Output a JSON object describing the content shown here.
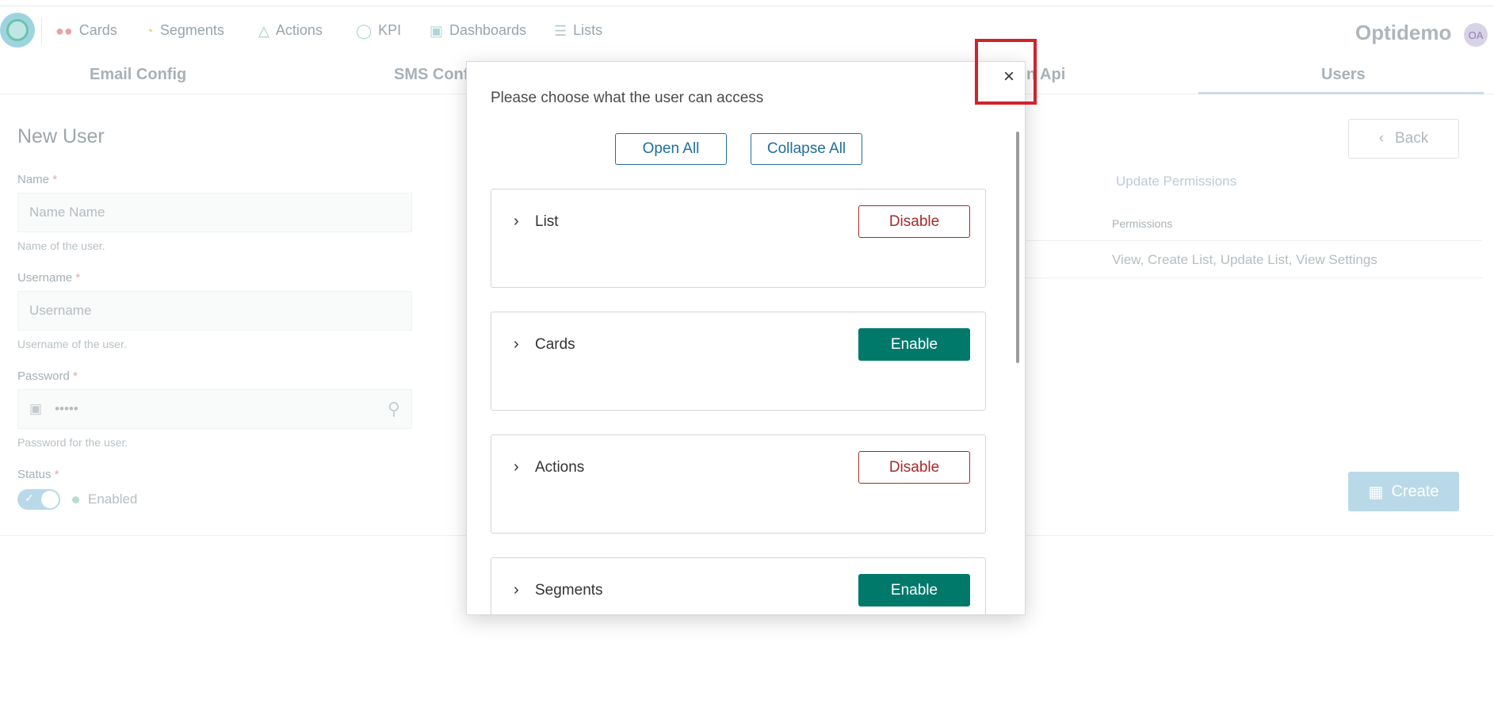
{
  "nav": {
    "items": [
      {
        "label": "Cards",
        "icon": "users-icon"
      },
      {
        "label": "Segments",
        "icon": "pie-icon"
      },
      {
        "label": "Actions",
        "icon": "actions-icon"
      },
      {
        "label": "KPI",
        "icon": "gauge-icon"
      },
      {
        "label": "Dashboards",
        "icon": "dashboard-icon"
      },
      {
        "label": "Lists",
        "icon": "list-icon"
      }
    ],
    "brand": "Optidemo",
    "avatar": "OA"
  },
  "tabs": {
    "email": "Email Config",
    "sms": "SMS Conf",
    "api": "n Api",
    "users": "Users"
  },
  "form": {
    "title": "New User",
    "name_label": "Name",
    "name_placeholder": "Name Name",
    "name_help": "Name of the user.",
    "username_label": "Username",
    "username_placeholder": "Username",
    "username_help": "Username of the user.",
    "password_label": "Password",
    "password_value": "•••••",
    "password_help": "Password for the user.",
    "status_label": "Status",
    "status_value": "Enabled",
    "required_mark": "*"
  },
  "right_panel": {
    "back_label": "Back",
    "update_permissions": "Update Permissions",
    "permissions_header": "Permissions",
    "permissions_value": "View, Create List, Update List, View Settings",
    "create_label": "Create"
  },
  "modal": {
    "title": "Please choose what the user can access",
    "close_glyph": "×",
    "open_all": "Open All",
    "collapse_all": "Collapse All",
    "sections": [
      {
        "label": "List",
        "action": "Disable",
        "state": "disable"
      },
      {
        "label": "Cards",
        "action": "Enable",
        "state": "enable"
      },
      {
        "label": "Actions",
        "action": "Disable",
        "state": "disable"
      },
      {
        "label": "Segments",
        "action": "Enable",
        "state": "enable"
      }
    ]
  },
  "colors": {
    "enable": "#00796b",
    "disable": "#a52a2a",
    "outline": "#256f9b",
    "highlight": "#d0232a"
  }
}
